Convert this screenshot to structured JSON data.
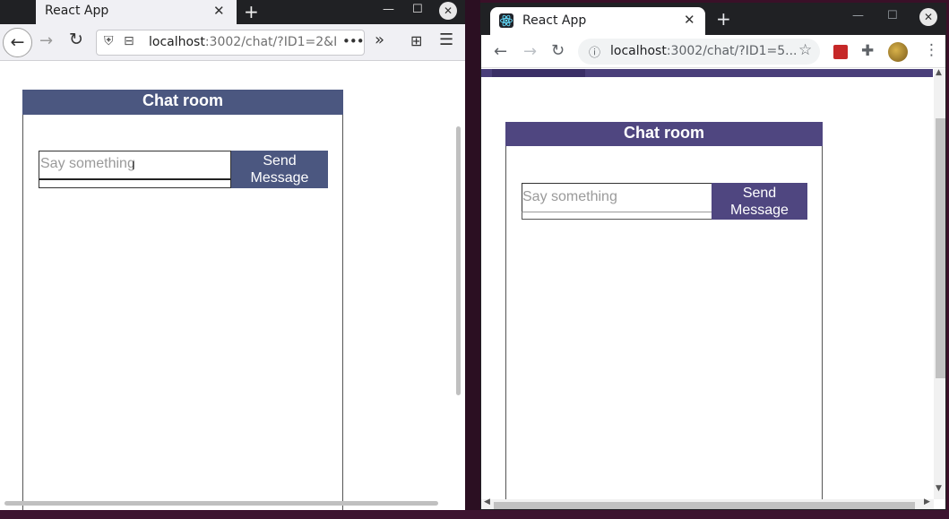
{
  "left_window": {
    "tab_title": "React App",
    "url_host": "localhost",
    "url_rest": ":3002/chat/?ID1=2&I",
    "chat": {
      "title": "Chat room",
      "placeholder": "Say something",
      "send_label_line1": "Send",
      "send_label_line2": "Message"
    },
    "colors": {
      "header": "#4b5780",
      "button": "#4b5780"
    }
  },
  "right_window": {
    "tab_title": "React App",
    "url_host": "localhost",
    "url_rest": ":3002/chat/?ID1=5...",
    "chat": {
      "title": "Chat room",
      "placeholder": "Say something",
      "send_label_line1": "Send",
      "send_label_line2": "Message"
    },
    "colors": {
      "header": "#4f4680",
      "button": "#4f4680"
    }
  },
  "icons": {
    "back": "←",
    "forward": "→",
    "reload": "↻",
    "close": "✕",
    "new_tab": "+",
    "minimize": "—",
    "maximize": "☐",
    "overflow": "»",
    "menu": "☰",
    "more": "•••",
    "star": "☆",
    "kebab": "⋮",
    "puzzle": "✚",
    "info": "ⓘ",
    "shield": "⛨",
    "lock": "⊟",
    "extensions": "⊞"
  }
}
